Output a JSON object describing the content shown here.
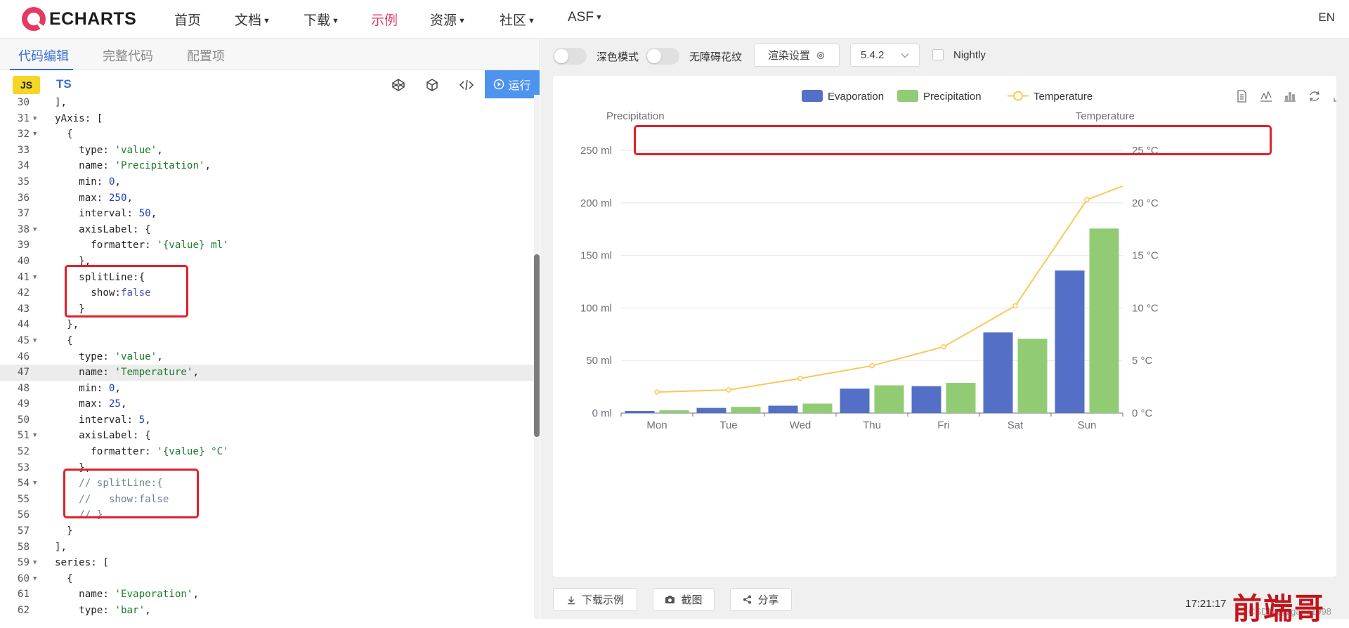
{
  "nav": {
    "brand": "ECHARTS",
    "items": [
      {
        "label": "首页",
        "caret": false
      },
      {
        "label": "文档",
        "caret": true
      },
      {
        "label": "下载",
        "caret": true
      },
      {
        "label": "示例",
        "caret": false,
        "active": true
      },
      {
        "label": "资源",
        "caret": true
      },
      {
        "label": "社区",
        "caret": true
      },
      {
        "label": "ASF",
        "caret": true
      }
    ],
    "lang": "EN"
  },
  "editor": {
    "tabs": [
      "代码编辑",
      "完整代码",
      "配置项"
    ],
    "active_tab": 0,
    "js_badge": "JS",
    "ts_label": "TS",
    "run_label": "运行",
    "highlighted_line": 47,
    "lines": [
      {
        "n": "30",
        "fold": false,
        "html": "],"
      },
      {
        "n": "31",
        "fold": true,
        "html": "yAxis: ["
      },
      {
        "n": "32",
        "fold": true,
        "html": "  {"
      },
      {
        "n": "33",
        "fold": false,
        "html": "    type: <span class='s'>'value'</span>,"
      },
      {
        "n": "34",
        "fold": false,
        "html": "    name: <span class='s'>'Precipitation'</span>,"
      },
      {
        "n": "35",
        "fold": false,
        "html": "    min: <span class='n'>0</span>,"
      },
      {
        "n": "36",
        "fold": false,
        "html": "    max: <span class='n'>250</span>,"
      },
      {
        "n": "37",
        "fold": false,
        "html": "    interval: <span class='n'>50</span>,"
      },
      {
        "n": "38",
        "fold": true,
        "html": "    axisLabel: {"
      },
      {
        "n": "39",
        "fold": false,
        "html": "      formatter: <span class='s'>'{value} ml'</span>"
      },
      {
        "n": "40",
        "fold": false,
        "html": "    },"
      },
      {
        "n": "41",
        "fold": true,
        "html": "    splitLine:{"
      },
      {
        "n": "42",
        "fold": false,
        "html": "      show:<span class='k'>false</span>"
      },
      {
        "n": "43",
        "fold": false,
        "html": "    }"
      },
      {
        "n": "44",
        "fold": false,
        "html": "  },"
      },
      {
        "n": "45",
        "fold": true,
        "html": "  {"
      },
      {
        "n": "46",
        "fold": false,
        "html": "    type: <span class='s'>'value'</span>,"
      },
      {
        "n": "47",
        "fold": false,
        "html": "    name: <span class='s'>'Temperature'</span>,"
      },
      {
        "n": "48",
        "fold": false,
        "html": "    min: <span class='n'>0</span>,"
      },
      {
        "n": "49",
        "fold": false,
        "html": "    max: <span class='n'>25</span>,"
      },
      {
        "n": "50",
        "fold": false,
        "html": "    interval: <span class='n'>5</span>,"
      },
      {
        "n": "51",
        "fold": true,
        "html": "    axisLabel: {"
      },
      {
        "n": "52",
        "fold": false,
        "html": "      formatter: <span class='s'>'{value} °C'</span>"
      },
      {
        "n": "53",
        "fold": false,
        "html": "    },"
      },
      {
        "n": "54",
        "fold": true,
        "html": "    <span class='c'>// splitLine:{</span>"
      },
      {
        "n": "55",
        "fold": false,
        "html": "    <span class='c'>//   show:false</span>"
      },
      {
        "n": "56",
        "fold": false,
        "html": "    <span class='c'>// }</span>"
      },
      {
        "n": "57",
        "fold": false,
        "html": "  }"
      },
      {
        "n": "58",
        "fold": false,
        "html": "],"
      },
      {
        "n": "59",
        "fold": true,
        "html": "series: ["
      },
      {
        "n": "60",
        "fold": true,
        "html": "  {"
      },
      {
        "n": "61",
        "fold": false,
        "html": "    name: <span class='s'>'Evaporation'</span>,"
      },
      {
        "n": "62",
        "fold": false,
        "html": "    type: <span class='s'>'bar'</span>,"
      }
    ]
  },
  "preview_toolbar": {
    "dark_mode_label": "深色模式",
    "aria_label": "无障碍花纹",
    "render_settings_label": "渲染设置",
    "version": "5.4.2",
    "nightly_label": "Nightly"
  },
  "chart_data": {
    "type": "bar",
    "categories": [
      "Mon",
      "Tue",
      "Wed",
      "Thu",
      "Fri",
      "Sat",
      "Sun"
    ],
    "series": [
      {
        "name": "Evaporation",
        "type": "bar",
        "axis": "left",
        "color": "#5470c6",
        "values": [
          2.0,
          4.9,
          7.0,
          23.2,
          25.6,
          76.7,
          135.6
        ]
      },
      {
        "name": "Precipitation",
        "type": "bar",
        "axis": "left",
        "color": "#91cc75",
        "values": [
          2.6,
          5.9,
          9.0,
          26.4,
          28.7,
          70.7,
          175.6
        ]
      },
      {
        "name": "Temperature",
        "type": "line",
        "axis": "right",
        "color": "#fac858",
        "values": [
          2.0,
          2.2,
          3.3,
          4.5,
          6.3,
          10.2,
          20.3
        ]
      }
    ],
    "y_left": {
      "name": "Precipitation",
      "min": 0,
      "max": 250,
      "interval": 50,
      "unit": "ml",
      "ticks": [
        "0 ml",
        "50 ml",
        "100 ml",
        "150 ml",
        "200 ml",
        "250 ml"
      ],
      "split_line": false
    },
    "y_right": {
      "name": "Temperature",
      "min": 0,
      "max": 25,
      "interval": 5,
      "unit": "°C",
      "ticks": [
        "0 °C",
        "5 °C",
        "10 °C",
        "15 °C",
        "20 °C",
        "25 °C"
      ],
      "split_line": true
    },
    "legend": {
      "position": "top-center",
      "items": [
        "Evaporation",
        "Precipitation",
        "Temperature"
      ]
    },
    "grid": true
  },
  "chart_tools": [
    "data-view-icon",
    "line-chart-icon",
    "bar-chart-icon",
    "restore-icon",
    "save-image-icon"
  ],
  "bottom": {
    "download_label": "下载示例",
    "screenshot_label": "截图",
    "share_label": "分享",
    "timestamp": "17:21:17",
    "credit": "CSDN @zgang1998",
    "watermark": "前端哥"
  },
  "colors": {
    "accent": "#e43961",
    "primary": "#3a6fd0",
    "run": "#4e93ee",
    "annotation": "#e0202a"
  }
}
